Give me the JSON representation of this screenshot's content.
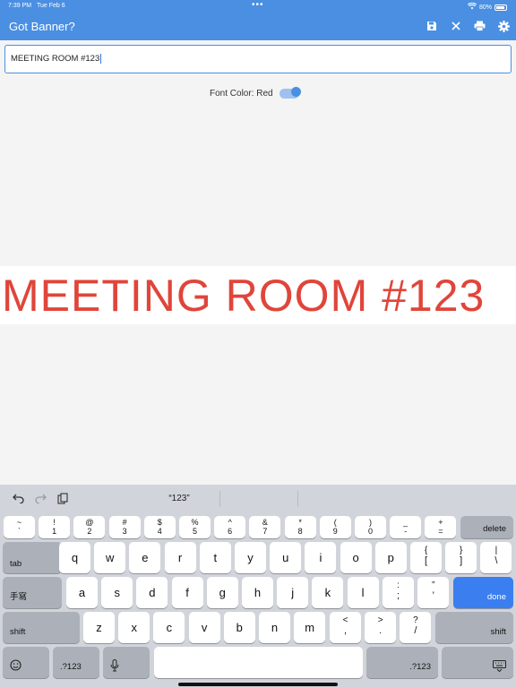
{
  "status": {
    "time": "7:39 PM",
    "date": "Tue Feb 6",
    "battery": "80%"
  },
  "header": {
    "title": "Got Banner?",
    "icons": [
      "save-icon",
      "close-icon",
      "print-icon",
      "gear-icon"
    ]
  },
  "input": {
    "value": "MEETING ROOM #123"
  },
  "font_color": {
    "label": "Font Color: Red",
    "on": true
  },
  "banner": {
    "text": "MEETING ROOM #123",
    "color": "#e0453a"
  },
  "colors": {
    "accent": "#4a8fe2",
    "banner_red": "#e0453a",
    "return_key": "#3a7ef0"
  },
  "keyboard": {
    "suggestion": "“123”",
    "number_row": [
      {
        "top": "~",
        "bot": "`"
      },
      {
        "top": "!",
        "bot": "1"
      },
      {
        "top": "@",
        "bot": "2"
      },
      {
        "top": "#",
        "bot": "3"
      },
      {
        "top": "$",
        "bot": "4"
      },
      {
        "top": "%",
        "bot": "5"
      },
      {
        "top": "^",
        "bot": "6"
      },
      {
        "top": "&",
        "bot": "7"
      },
      {
        "top": "*",
        "bot": "8"
      },
      {
        "top": "(",
        "bot": "9"
      },
      {
        "top": ")",
        "bot": "0"
      },
      {
        "top": "_",
        "bot": "-"
      },
      {
        "top": "+",
        "bot": "="
      }
    ],
    "delete": "delete",
    "tab": "tab",
    "row2": [
      "q",
      "w",
      "e",
      "r",
      "t",
      "y",
      "u",
      "i",
      "o",
      "p"
    ],
    "row2_extra": [
      {
        "top": "{",
        "bot": "["
      },
      {
        "top": "}",
        "bot": "]"
      },
      {
        "top": "|",
        "bot": "\\"
      }
    ],
    "handwriting": "手寫",
    "row3": [
      "a",
      "s",
      "d",
      "f",
      "g",
      "h",
      "j",
      "k",
      "l"
    ],
    "row3_extra": [
      {
        "top": ":",
        "bot": ";"
      },
      {
        "top": "”",
        "bot": "’"
      }
    ],
    "done": "done",
    "shift": "shift",
    "row4": [
      "z",
      "x",
      "c",
      "v",
      "b",
      "n",
      "m"
    ],
    "row4_extra": [
      {
        "top": "<",
        "bot": ","
      },
      {
        "top": ">",
        "bot": "."
      },
      {
        "top": "?",
        "bot": "/"
      }
    ],
    "numbers_key": ".?123"
  }
}
